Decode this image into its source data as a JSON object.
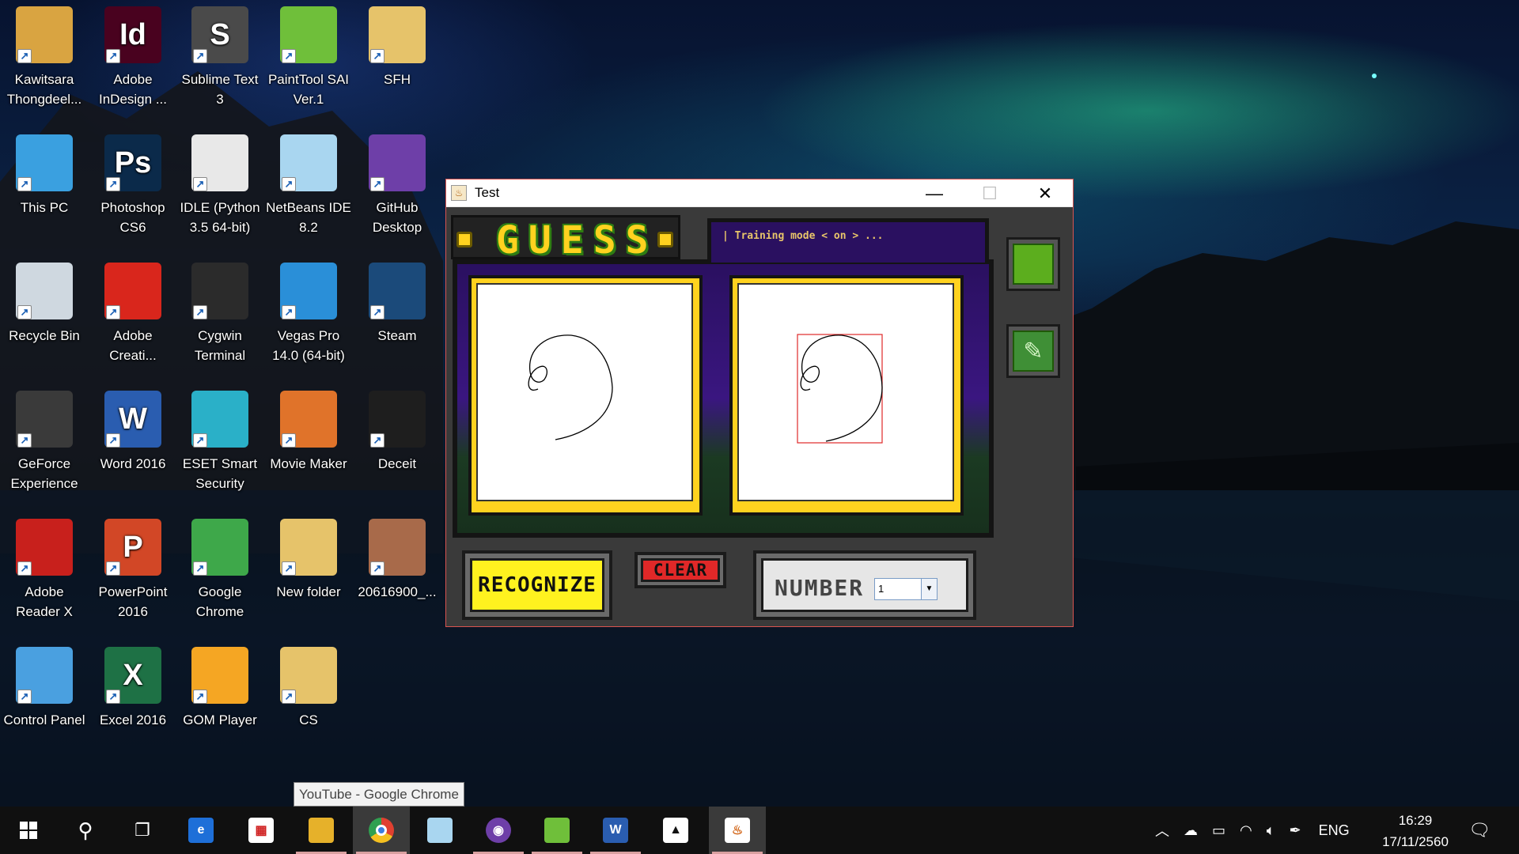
{
  "desktop": {
    "icons": [
      {
        "label": "Kawitsara Thongdeel...",
        "icon": "user-folder-icon",
        "color": "#d9a441"
      },
      {
        "label": "Adobe InDesign ...",
        "icon": "indesign-icon",
        "glyph": "Id",
        "color": "#49021f"
      },
      {
        "label": "Sublime Text 3",
        "icon": "sublime-text-icon",
        "glyph": "S",
        "color": "#4a4a4a"
      },
      {
        "label": "PaintTool SAI Ver.1",
        "icon": "painttool-sai-icon",
        "glyph": "",
        "color": "#6fbf3a"
      },
      {
        "label": "SFH",
        "icon": "folder-icon",
        "glyph": "",
        "color": "#e6c36a"
      },
      {
        "label": "This PC",
        "icon": "computer-icon",
        "glyph": "",
        "color": "#3aa0e0"
      },
      {
        "label": "Photoshop CS6",
        "icon": "photoshop-icon",
        "glyph": "Ps",
        "color": "#0b2a4a"
      },
      {
        "label": "IDLE (Python 3.5 64-bit)",
        "icon": "python-idle-icon",
        "glyph": "",
        "color": "#e8e8e8"
      },
      {
        "label": "NetBeans IDE 8.2",
        "icon": "netbeans-icon",
        "glyph": "",
        "color": "#a9d6f0"
      },
      {
        "label": "GitHub Desktop",
        "icon": "github-desktop-icon",
        "glyph": "",
        "color": "#6e3fa8"
      },
      {
        "label": "Recycle Bin",
        "icon": "recycle-bin-icon",
        "glyph": "",
        "color": "#cfd8e0"
      },
      {
        "label": "Adobe Creati...",
        "icon": "creative-cloud-icon",
        "glyph": "",
        "color": "#d9261c"
      },
      {
        "label": "Cygwin Terminal",
        "icon": "cygwin-terminal-icon",
        "glyph": "",
        "color": "#2b2b2b"
      },
      {
        "label": "Vegas Pro 14.0 (64-bit)",
        "icon": "vegas-pro-icon",
        "glyph": "",
        "color": "#2a8fd8"
      },
      {
        "label": "Steam",
        "icon": "steam-icon",
        "glyph": "",
        "color": "#1b4a7a"
      },
      {
        "label": "GeForce Experience",
        "icon": "geforce-icon",
        "glyph": "",
        "color": "#3a3a3a"
      },
      {
        "label": "Word 2016",
        "icon": "word-icon",
        "glyph": "W",
        "color": "#2a5db0"
      },
      {
        "label": "ESET Smart Security",
        "icon": "eset-icon",
        "glyph": "",
        "color": "#2ab0c8"
      },
      {
        "label": "Movie Maker",
        "icon": "movie-maker-icon",
        "glyph": "",
        "color": "#e0732a"
      },
      {
        "label": "Deceit",
        "icon": "deceit-icon",
        "glyph": "",
        "color": "#1e1e1e"
      },
      {
        "label": "Adobe Reader X",
        "icon": "adobe-reader-icon",
        "glyph": "",
        "color": "#c8201c"
      },
      {
        "label": "PowerPoint 2016",
        "icon": "powerpoint-icon",
        "glyph": "P",
        "color": "#d24726"
      },
      {
        "label": "Google Chrome",
        "icon": "chrome-icon",
        "glyph": "",
        "color": "#3ea84a"
      },
      {
        "label": "New folder",
        "icon": "folder-icon",
        "glyph": "",
        "color": "#e6c36a"
      },
      {
        "label": "20616900_...",
        "icon": "image-file-icon",
        "glyph": "",
        "color": "#a86a4a"
      },
      {
        "label": "Control Panel",
        "icon": "control-panel-icon",
        "glyph": "",
        "color": "#4aa0e0"
      },
      {
        "label": "Excel 2016",
        "icon": "excel-icon",
        "glyph": "X",
        "color": "#1e7145"
      },
      {
        "label": "GOM Player",
        "icon": "gom-player-icon",
        "glyph": "",
        "color": "#f5a623"
      },
      {
        "label": "CS",
        "icon": "folder-icon",
        "glyph": "",
        "color": "#e6c36a"
      }
    ]
  },
  "window": {
    "title": "Test",
    "logo": "GUESS",
    "status": "| Training mode < on > ...",
    "recognize_label": "RECOGNIZE",
    "clear_label": "CLEAR",
    "number_label": "NUMBER",
    "number_value": "1"
  },
  "tooltip": "YouTube - Google Chrome",
  "taskbar": {
    "language": "ENG",
    "time": "16:29",
    "date": "17/11/2560"
  }
}
